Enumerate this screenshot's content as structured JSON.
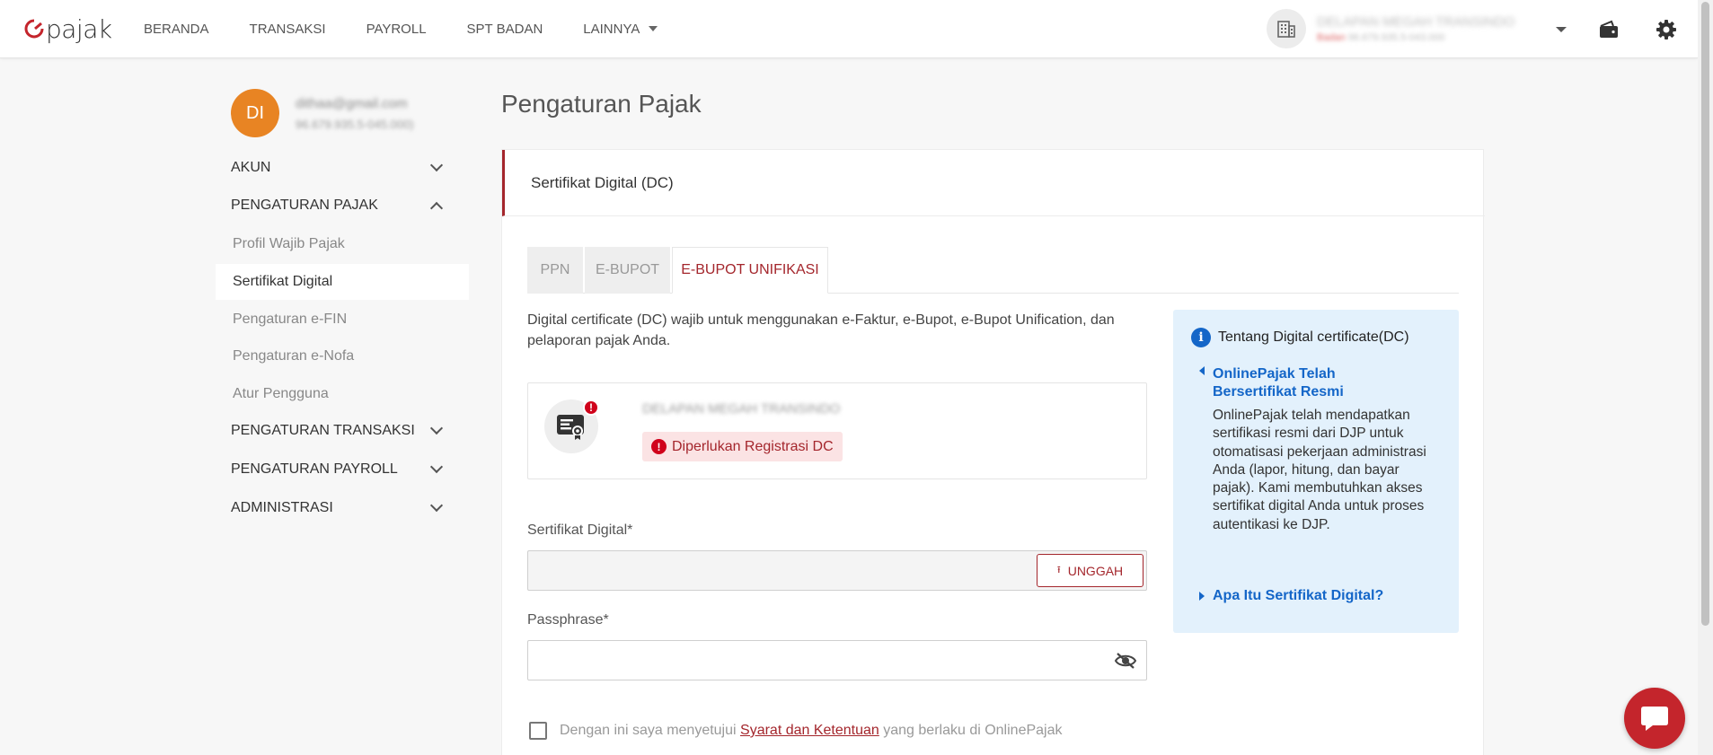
{
  "brand": {
    "logo_text": "pajak",
    "accent": "#a4262c",
    "avatar_color": "#e88423",
    "info_bg": "#e3f1fc",
    "link_blue": "#1466c8"
  },
  "nav": {
    "items": [
      "BERANDA",
      "TRANSAKSI",
      "PAYROLL",
      "SPT BADAN",
      "LAINNYA"
    ]
  },
  "company": {
    "name": "DELAPAN MEGAH TRANSINDO",
    "status": "Badan",
    "npwp": "96.679.935.5-043.000"
  },
  "profile": {
    "initials": "DI",
    "email": "dithaa@gmail.com",
    "npwp": "96.679.935.5-045.000",
    "npwp_suffix": ")"
  },
  "sidebar": {
    "sections": [
      {
        "label": "AKUN",
        "expanded": false
      },
      {
        "label": "PENGATURAN PAJAK",
        "expanded": true
      },
      {
        "label": "PENGATURAN TRANSAKSI",
        "expanded": false
      },
      {
        "label": "PENGATURAN PAYROLL",
        "expanded": false
      },
      {
        "label": "ADMINISTRASI",
        "expanded": false
      }
    ],
    "subitems": [
      "Profil Wajib Pajak",
      "Sertifikat Digital",
      "Pengaturan e-FIN",
      "Pengaturan e-Nofa",
      "Atur Pengguna"
    ],
    "active_subitem": "Sertifikat Digital"
  },
  "main": {
    "page_title": "Pengaturan Pajak",
    "card_title": "Sertifikat Digital (DC)",
    "tabs": [
      {
        "label": "PPN",
        "active": false
      },
      {
        "label": "E-BUPOT",
        "active": false
      },
      {
        "label": "E-BUPOT UNIFIKASI",
        "active": true
      }
    ],
    "description": "Digital certificate (DC) wajib untuk menggunakan e-Faktur, e-Bupot, e-Bupot Unification, dan pelaporan pajak Anda.",
    "dc": {
      "company_name": "DELAPAN MEGAH TRANSINDO",
      "badge": "!",
      "status": "Diperlukan Registrasi DC"
    },
    "cert_field": {
      "label": "Sertifikat Digital*",
      "value": "",
      "button": "UNGGAH"
    },
    "pass_field": {
      "label": "Passphrase*",
      "value": ""
    },
    "agree": {
      "prefix": "Dengan ini saya menyetujui",
      "link": "Syarat dan Ketentuan",
      "suffix": "yang berlaku di OnlinePajak",
      "checked": false
    }
  },
  "info_panel": {
    "title": "Tentang Digital certificate(DC)",
    "acc1_title": "OnlinePajak Telah Bersertifikat Resmi",
    "acc1_body": "OnlinePajak telah mendapatkan sertifikasi resmi dari DJP untuk otomatisasi pekerjaan administrasi Anda (lapor, hitung, dan bayar pajak). Kami membutuhkan akses sertifikat digital Anda untuk proses autentikasi ke DJP.",
    "acc2_title": "Apa Itu Sertifikat Digital?"
  }
}
